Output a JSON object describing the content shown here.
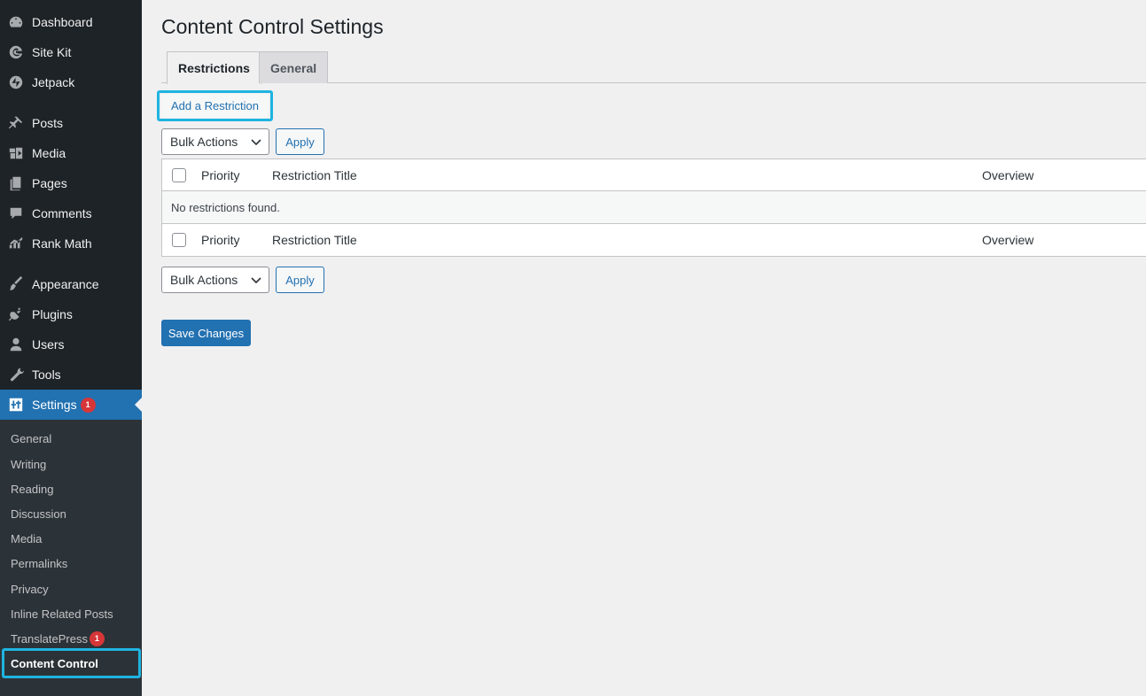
{
  "sidebar": {
    "items": [
      {
        "label": "Dashboard",
        "icon": "dashboard-icon"
      },
      {
        "label": "Site Kit",
        "icon": "google-g-icon"
      },
      {
        "label": "Jetpack",
        "icon": "jetpack-icon"
      },
      {
        "label": "Posts",
        "icon": "pin-icon"
      },
      {
        "label": "Media",
        "icon": "media-icon"
      },
      {
        "label": "Pages",
        "icon": "pages-icon"
      },
      {
        "label": "Comments",
        "icon": "comment-icon"
      },
      {
        "label": "Rank Math",
        "icon": "rank-math-icon"
      },
      {
        "label": "Appearance",
        "icon": "paintbrush-icon"
      },
      {
        "label": "Plugins",
        "icon": "plugin-icon"
      },
      {
        "label": "Users",
        "icon": "user-icon"
      },
      {
        "label": "Tools",
        "icon": "wrench-icon"
      },
      {
        "label": "Settings",
        "icon": "settings-icon",
        "badge": "1"
      }
    ],
    "submenu": [
      {
        "label": "General"
      },
      {
        "label": "Writing"
      },
      {
        "label": "Reading"
      },
      {
        "label": "Discussion"
      },
      {
        "label": "Media"
      },
      {
        "label": "Permalinks"
      },
      {
        "label": "Privacy"
      },
      {
        "label": "Inline Related Posts"
      },
      {
        "label": "TranslatePress",
        "badge": "1"
      },
      {
        "label": "Content Control"
      }
    ]
  },
  "page": {
    "title": "Content Control Settings",
    "tabs": [
      {
        "label": "Restrictions"
      },
      {
        "label": "General"
      }
    ],
    "add_button": "Add a Restriction",
    "bulk_top": {
      "select": "Bulk Actions",
      "apply": "Apply"
    },
    "bulk_bottom": {
      "select": "Bulk Actions",
      "apply": "Apply"
    },
    "table": {
      "columns": [
        "Priority",
        "Restriction Title",
        "Overview"
      ],
      "empty_message": "No restrictions found."
    },
    "save_button": "Save Changes"
  },
  "colors": {
    "sidebar_bg": "#1d2327",
    "submenu_bg": "#2c3338",
    "accent": "#2271b1",
    "highlight": "#1fb4e0",
    "badge": "#d63638"
  }
}
